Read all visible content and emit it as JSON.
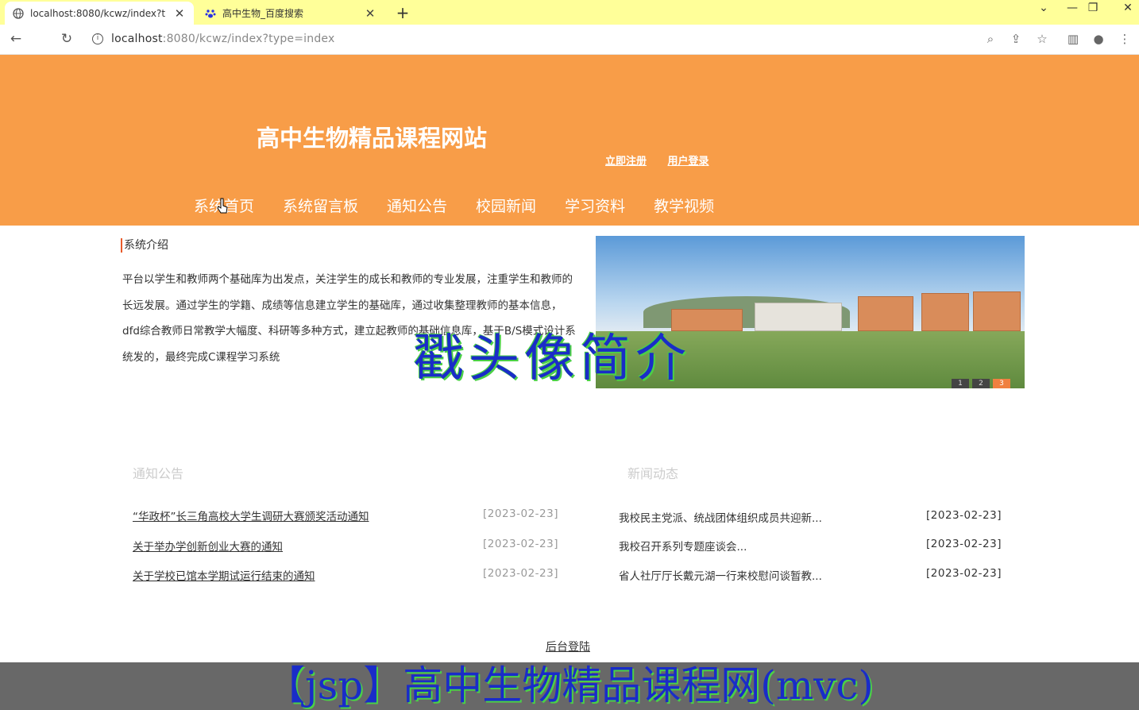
{
  "browser": {
    "tabs": [
      {
        "title": "localhost:8080/kcwz/index?t",
        "active": true
      },
      {
        "title": "高中生物_百度搜索",
        "active": false
      }
    ],
    "url_host": "localhost",
    "url_rest": ":8080/kcwz/index?type=index"
  },
  "site": {
    "title": "高中生物精品课程网站",
    "register_link": "立即注册",
    "login_link": "用户登录",
    "nav": [
      "系统首页",
      "系统留言板",
      "通知公告",
      "校园新闻",
      "学习资料",
      "教学视频"
    ]
  },
  "intro": {
    "heading": "系统介绍",
    "text": "平台以学生和教师两个基础库为出发点，关注学生的成长和教师的专业发展，注重学生和教师的长远发展。通过学生的学籍、成绩等信息建立学生的基础库，通过收集整理教师的基本信息，dfd综合教师日常教学大幅度、科研等多种方式，建立起教师的基础信息库，基于B/S模式设计系统发的，最终完成C课程学习系统"
  },
  "slider": {
    "pages": [
      "1",
      "2",
      "3"
    ],
    "active_index": 3
  },
  "watermark_overlay": "戳头像简介",
  "notices": {
    "title": "通知公告",
    "items": [
      {
        "title": "“华政杯”长三角高校大学生调研大赛颁奖活动通知",
        "date": "[2023-02-23]"
      },
      {
        "title": "关于举办学创新创业大赛的通知",
        "date": "[2023-02-23]"
      },
      {
        "title": "关于学校已馆本学期试运行结束的通知",
        "date": "[2023-02-23]"
      }
    ]
  },
  "news": {
    "title": "新闻动态",
    "items": [
      {
        "title": "我校民主党派、统战团体组织成员共迎新...",
        "date": "[2023-02-23]"
      },
      {
        "title": "我校召开系列专题座谈会...",
        "date": "[2023-02-23]"
      },
      {
        "title": "省人社厅厅长戴元湖一行来校慰问谈暂教...",
        "date": "[2023-02-23]"
      }
    ]
  },
  "footer": {
    "admin_login": "后台登陆"
  },
  "banner_text": "【jsp】高中生物精品课程网(mvc)",
  "colors": {
    "header_bg": "#f89d48",
    "tabbar_bg": "#ffff99",
    "banner_bg": "#686868",
    "overlay_text": "#1a2cc8"
  }
}
